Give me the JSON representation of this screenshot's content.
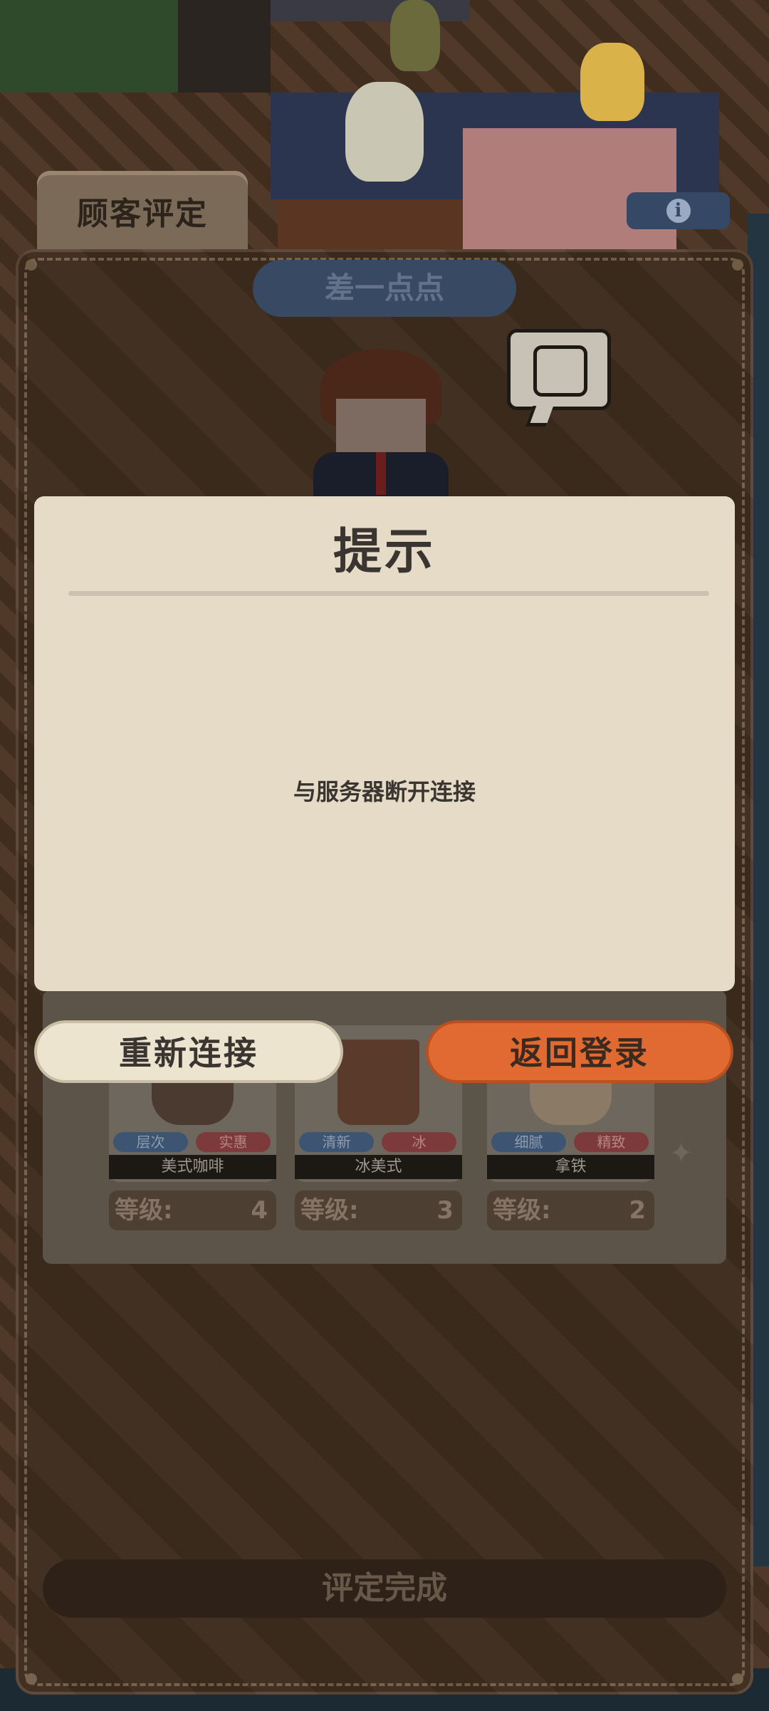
{
  "panel": {
    "tab_title": "顾客评定",
    "verdict": "差一点点",
    "complete_button": "评定完成"
  },
  "drinks": [
    {
      "name": "美式咖啡",
      "tags": [
        "层次",
        "实惠"
      ],
      "level_label": "等级:",
      "level": "4"
    },
    {
      "name": "冰美式",
      "tags": [
        "清新",
        "冰"
      ],
      "level_label": "等级:",
      "level": "3"
    },
    {
      "name": "拿铁",
      "tags": [
        "细腻",
        "精致"
      ],
      "level_label": "等级:",
      "level": "2"
    }
  ],
  "dialog": {
    "title": "提示",
    "message": "与服务器断开连接",
    "reconnect_button": "重新连接",
    "back_button": "返回登录"
  },
  "icons": {
    "info": "info-icon",
    "speech": "speech-bubble-icon",
    "sparkle": "sparkle-icon"
  },
  "colors": {
    "accent": "#e06a32",
    "dialog_bg": "#e5dbc6",
    "panel_bg": "#3d2c1e"
  }
}
